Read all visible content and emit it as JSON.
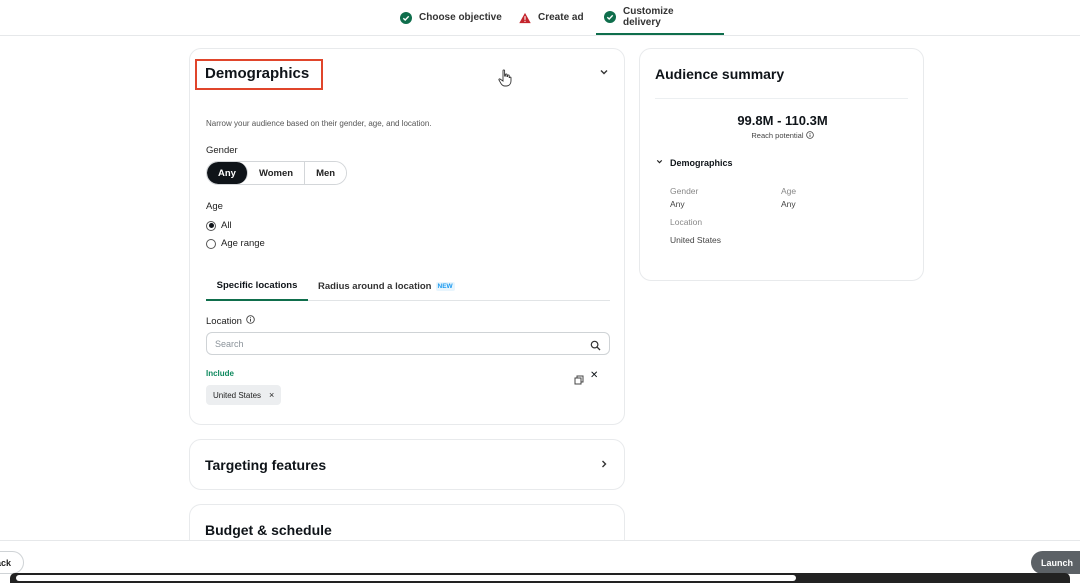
{
  "stepper": {
    "steps": [
      {
        "label": "Choose objective",
        "status": "complete"
      },
      {
        "label": "Create ad",
        "status": "warning"
      },
      {
        "label": "Customize delivery",
        "status": "active"
      }
    ]
  },
  "demographics": {
    "title": "Demographics",
    "description": "Narrow your audience based on their gender, age, and location.",
    "gender_label": "Gender",
    "gender_options": [
      "Any",
      "Women",
      "Men"
    ],
    "gender_selected": "Any",
    "age_label": "Age",
    "age_options": [
      "All",
      "Age range"
    ],
    "age_selected": "All",
    "tabs": [
      {
        "label": "Specific locations",
        "active": true
      },
      {
        "label": "Radius around a location",
        "badge": "NEW",
        "active": false
      }
    ],
    "location_label": "Location",
    "search_placeholder": "Search",
    "search_value": "",
    "include_label": "Include",
    "included_locations": [
      "United States"
    ]
  },
  "targeting": {
    "title": "Targeting features"
  },
  "budget": {
    "title": "Budget & schedule"
  },
  "summary": {
    "title": "Audience summary",
    "reach": "99.8M - 110.3M",
    "reach_label": "Reach potential",
    "section": "Demographics",
    "gender_key": "Gender",
    "gender_value": "Any",
    "age_key": "Age",
    "age_value": "Any",
    "location_key": "Location",
    "location_value": "United States"
  },
  "footer": {
    "back_label": "Back",
    "launch_label": "Launch"
  },
  "colors": {
    "accent_green": "#0f6e4c",
    "warning_red": "#c4242c",
    "highlight_box": "#e0452b"
  }
}
